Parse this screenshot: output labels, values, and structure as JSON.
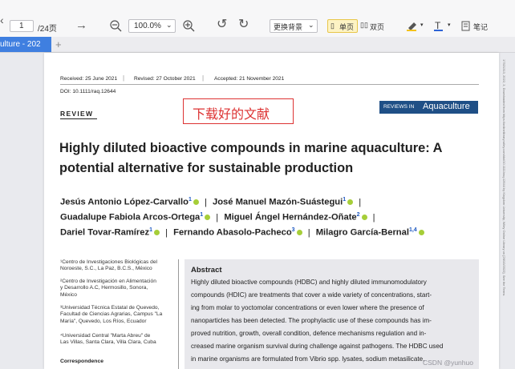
{
  "toolbar": {
    "page_input": "1",
    "page_total": "/24页",
    "zoom": "100.0%",
    "background_select": "更换背景",
    "single_page": "单页",
    "double_page": "双页",
    "notes": "笔记",
    "icons": [
      "prev-page-icon",
      "next-page-arrow-icon",
      "zoom-out-icon",
      "zoom-in-icon",
      "rotate-left-icon",
      "rotate-right-icon",
      "highlighter-icon",
      "text-tool-icon",
      "notes-icon"
    ]
  },
  "tabs": {
    "active": "ulture - 202",
    "add": "+"
  },
  "paper": {
    "received": "Received: 25 June 2021",
    "revised": "Revised: 27 October 2021",
    "accepted": "Accepted: 21 November 2021",
    "doi": "DOI: 10.1111/raq.12644",
    "section": "REVIEW",
    "stamp": "下载好的文献",
    "journal_prefix": "REVIEWS IN",
    "journal_name": "Aquaculture",
    "title_line1": "Highly diluted bioactive compounds in marine aquaculture: A",
    "title_line2": "potential alternative for sustainable production",
    "authors_line1": [
      {
        "name": "Jesús Antonio López-Carvallo",
        "sup": "1"
      },
      {
        "name": "José Manuel Mazón-Suástegui",
        "sup": "1"
      }
    ],
    "authors_line2": [
      {
        "name": "Guadalupe Fabiola Arcos-Ortega",
        "sup": "1"
      },
      {
        "name": "Miguel Ángel Hernández-Oñate",
        "sup": "2"
      }
    ],
    "authors_line3": [
      {
        "name": "Dariel Tovar-Ramírez",
        "sup": "1"
      },
      {
        "name": "Fernando Abasolo-Pacheco",
        "sup": "3"
      },
      {
        "name": "Milagro García-Bernal",
        "sup": "1,4"
      }
    ],
    "separator": "|",
    "affiliations": [
      "¹Centro de Investigaciones Biológicas del\nNoroeste, S.C., La Paz, B.C.S., México",
      "²Centro de Investigación en Alimentación\ny Desarrollo A.C, Hermosillo, Sonora,\nMéxico",
      "³Universidad Técnica Estatal de Quevedo,\nFacultad de Ciencias Agrarias, Campus \"La\nMaría\", Quevedo, Los Ríos, Ecuador",
      "⁴Universidad Central \"Marta Abreu\" de\nLas Villas, Santa Clara, Villa Clara, Cuba"
    ],
    "correspondence": "Correspondence",
    "abstract_heading": "Abstract",
    "abstract_lines": [
      "Highly diluted bioactive compounds (HDBC) and highly diluted immunomodulatory",
      "compounds (HDIC) are treatments that cover a wide variety of concentrations, start-",
      "ing from molar to yoctomolar concentrations or even lower where the presence of",
      "nanoparticles has been detected. The prophylactic use of these compounds has im-",
      "proved nutrition, growth, overall condition, defence mechanisms regulation and in-",
      "creased marine organism survival during challenge against pathogens. The HDBC used",
      "in marine organisms are formulated from Vibrio spp. lysates, sodium metasilicate,"
    ],
    "watermark": "CSDN @yunhuo"
  },
  "side_text": "17521313, 2022, 3, Downloaded from https://onlinelibrary.wiley.com/doi/10.1111/raq.12644 by Kingdom University, Wiley Online Library on [26/10/2022]. See the Terms"
}
